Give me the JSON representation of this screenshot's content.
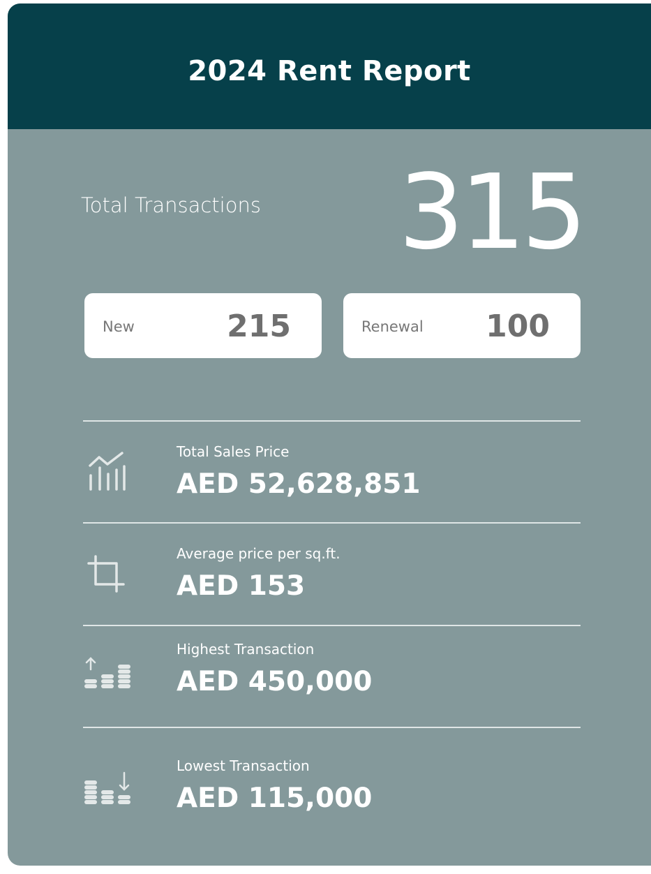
{
  "report": {
    "title": "2024 Rent Report",
    "total_label": "Total Transactions",
    "total_value": "315"
  },
  "breakdown": [
    {
      "label": "New",
      "value": "215"
    },
    {
      "label": "Renewal",
      "value": "100"
    }
  ],
  "metrics": [
    {
      "label": "Total Sales Price",
      "value": "AED 52,628,851",
      "icon": "bar-chart-trend-icon"
    },
    {
      "label": "Average price per sq.ft.",
      "value": "AED 153",
      "icon": "crop-icon"
    },
    {
      "label": "Highest Transaction",
      "value": "AED 450,000",
      "icon": "coins-up-icon"
    },
    {
      "label": "Lowest Transaction",
      "value": "AED 115,000",
      "icon": "coins-down-icon"
    }
  ],
  "colors": {
    "header": "#06404a",
    "card": "#84999b",
    "icon": "#e3e8e8"
  }
}
